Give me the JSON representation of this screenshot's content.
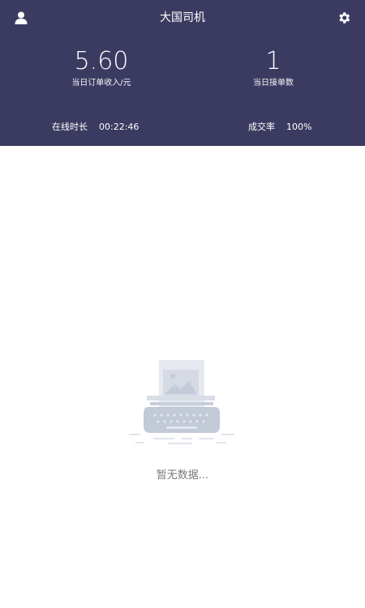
{
  "app": {
    "title": "大国司机"
  },
  "header": {
    "user_icon": "user-icon",
    "settings_icon": "gear-icon",
    "background_color": "#3b3b62"
  },
  "stats": {
    "income_value": "5.60",
    "income_label": "当日订单收入/元",
    "orders_value": "1",
    "orders_label": "当日接单数"
  },
  "metrics": {
    "online_label": "在线时长",
    "online_value": "00:22:46",
    "rate_label": "成交率",
    "rate_value": "100%"
  },
  "empty_state": {
    "illustration_icon": "typewriter-icon",
    "text": "暂无数据..."
  }
}
